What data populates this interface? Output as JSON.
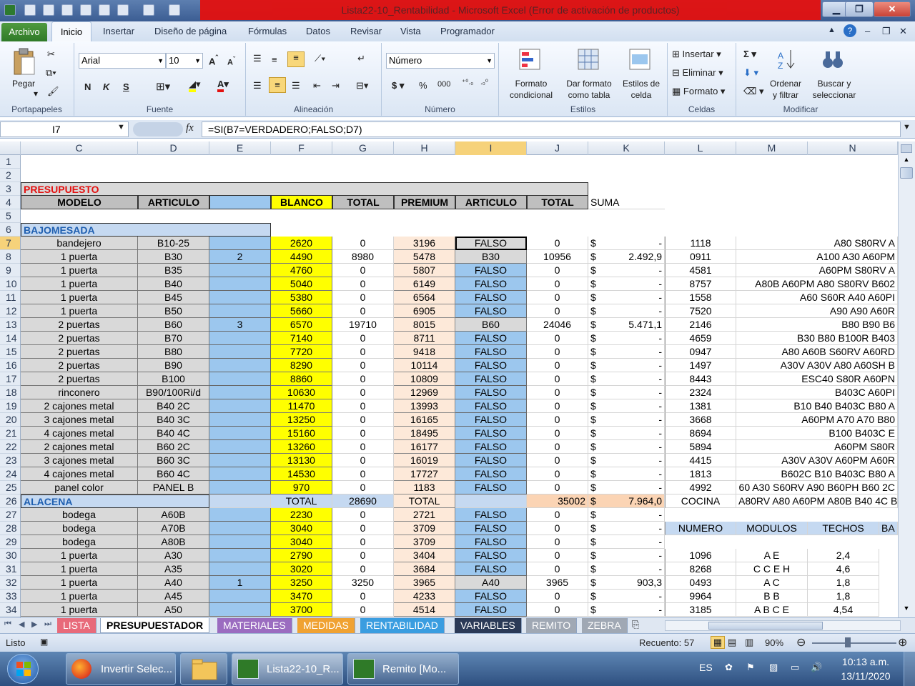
{
  "window": {
    "title": "Lista22-10_Rentabilidad  -  Microsoft Excel (Error de activación de productos)"
  },
  "ribbon_tabs": [
    "Archivo",
    "Inicio",
    "Insertar",
    "Diseño de página",
    "Fórmulas",
    "Datos",
    "Revisar",
    "Vista",
    "Programador"
  ],
  "ribbon": {
    "paste": "Pegar",
    "clipboard_group": "Portapapeles",
    "font_name": "Arial",
    "font_size": "10",
    "font_group": "Fuente",
    "bold": "N",
    "italic": "K",
    "underline": "S",
    "align_group": "Alineación",
    "number_format": "Número",
    "number_group": "Número",
    "percent": "%",
    "thousands": "000",
    "currency": "$",
    "cond_format_1": "Formato",
    "cond_format_2": "condicional",
    "table_format_1": "Dar formato",
    "table_format_2": "como tabla",
    "cell_styles_1": "Estilos de",
    "cell_styles_2": "celda",
    "styles_group": "Estilos",
    "insert": "Insertar",
    "delete": "Eliminar",
    "format": "Formato",
    "cells_group": "Celdas",
    "sort_1": "Ordenar",
    "sort_2": "y filtrar",
    "find_1": "Buscar y",
    "find_2": "seleccionar",
    "modify_group": "Modificar"
  },
  "formula_bar": {
    "name_box": "I7",
    "fx": "fx",
    "formula": "=SI(B7=VERDADERO;FALSO;D7)"
  },
  "columns": [
    "C",
    "D",
    "E",
    "F",
    "G",
    "H",
    "I",
    "J",
    "K",
    "L",
    "M",
    "N"
  ],
  "rows": [
    "1",
    "2",
    "3",
    "4",
    "5",
    "6",
    "7",
    "8",
    "9",
    "10",
    "11",
    "12",
    "13",
    "14",
    "15",
    "16",
    "17",
    "18",
    "19",
    "20",
    "21",
    "22",
    "23",
    "24",
    "25",
    "26",
    "27",
    "28",
    "29",
    "30",
    "31",
    "32",
    "33",
    "34"
  ],
  "sheet": {
    "presupuesto": "PRESUPUESTO",
    "headers": [
      "MODELO",
      "ARTICULO",
      "",
      "BLANCO",
      "TOTAL",
      "PREMIUM",
      "ARTICULO",
      "TOTAL"
    ],
    "suma": "SUMA",
    "bajomesada": "BAJOMESADA",
    "alacena": "ALACENA",
    "total_label": "TOTAL",
    "total_g": "28690",
    "total_label2": "TOTAL",
    "total_j": "35002",
    "total_k": "7.964,0",
    "cocina": "COCINA",
    "cocina_m": "A80RV A80 A60PM A80B B40 4C B",
    "lower_headers": [
      "NUMERO",
      "MODULOS",
      "TECHOS",
      "BA"
    ],
    "rows_bm": [
      [
        "bandejero",
        "B10-25",
        "",
        "2620",
        "0",
        "3196",
        "FALSO",
        "0",
        "$",
        "-",
        "1118",
        "A80 S80RV A"
      ],
      [
        "1 puerta",
        "B30",
        "2",
        "4490",
        "8980",
        "5478",
        "B30",
        "10956",
        "$",
        "2.492,9",
        "0911",
        "A100 A30 A60PM"
      ],
      [
        "1 puerta",
        "B35",
        "",
        "4760",
        "0",
        "5807",
        "FALSO",
        "0",
        "$",
        "-",
        "4581",
        "A60PM S80RV A"
      ],
      [
        "1 puerta",
        "B40",
        "",
        "5040",
        "0",
        "6149",
        "FALSO",
        "0",
        "$",
        "-",
        "8757",
        "A80B A60PM A80 S80RV B602"
      ],
      [
        "1 puerta",
        "B45",
        "",
        "5380",
        "0",
        "6564",
        "FALSO",
        "0",
        "$",
        "-",
        "1558",
        "A60 S60R A40 A60PI"
      ],
      [
        "1 puerta",
        "B50",
        "",
        "5660",
        "0",
        "6905",
        "FALSO",
        "0",
        "$",
        "-",
        "7520",
        "A90 A90 A60R"
      ],
      [
        "2 puertas",
        "B60",
        "3",
        "6570",
        "19710",
        "8015",
        "B60",
        "24046",
        "$",
        "5.471,1",
        "2146",
        "B80 B90 B6"
      ],
      [
        "2 puertas",
        "B70",
        "",
        "7140",
        "0",
        "8711",
        "FALSO",
        "0",
        "$",
        "-",
        "4659",
        "B30 B80 B100R B403"
      ],
      [
        "2 puertas",
        "B80",
        "",
        "7720",
        "0",
        "9418",
        "FALSO",
        "0",
        "$",
        "-",
        "0947",
        "A80 A60B S60RV A60RD"
      ],
      [
        "2 puertas",
        "B90",
        "",
        "8290",
        "0",
        "10114",
        "FALSO",
        "0",
        "$",
        "-",
        "1497",
        "A30V A30V A80 A60SH B"
      ],
      [
        "2 puertas",
        "B100",
        "",
        "8860",
        "0",
        "10809",
        "FALSO",
        "0",
        "$",
        "-",
        "8443",
        "ESC40 S80R A60PN"
      ],
      [
        "rinconero",
        "B90/100Ri/d",
        "",
        "10630",
        "0",
        "12969",
        "FALSO",
        "0",
        "$",
        "-",
        "2324",
        "B403C A60PI"
      ],
      [
        "2 cajones metal",
        "B40 2C",
        "",
        "11470",
        "0",
        "13993",
        "FALSO",
        "0",
        "$",
        "-",
        "1381",
        "B10 B40 B403C B80 A"
      ],
      [
        "3 cajones metal",
        "B40 3C",
        "",
        "13250",
        "0",
        "16165",
        "FALSO",
        "0",
        "$",
        "-",
        "3668",
        "A60PM A70 A70 B80"
      ],
      [
        "4 cajones metal",
        "B40 4C",
        "",
        "15160",
        "0",
        "18495",
        "FALSO",
        "0",
        "$",
        "-",
        "8694",
        "B100 B403C E"
      ],
      [
        "2 cajones metal",
        "B60 2C",
        "",
        "13260",
        "0",
        "16177",
        "FALSO",
        "0",
        "$",
        "-",
        "5894",
        "A60PM S80R"
      ],
      [
        "3 cajones metal",
        "B60 3C",
        "",
        "13130",
        "0",
        "16019",
        "FALSO",
        "0",
        "$",
        "-",
        "4415",
        "A30V A30V A60PM A60R"
      ],
      [
        "4 cajones metal",
        "B60 4C",
        "",
        "14530",
        "0",
        "17727",
        "FALSO",
        "0",
        "$",
        "-",
        "1813",
        "B602C B10 B403C B80 A"
      ],
      [
        "panel color",
        "PANEL B",
        "",
        "970",
        "0",
        "1183",
        "FALSO",
        "0",
        "$",
        "-",
        "4992",
        "60 A30 S60RV A90 B60PH B60 2C"
      ]
    ],
    "rows_al": [
      [
        "bodega",
        "A60B",
        "",
        "2230",
        "0",
        "2721",
        "FALSO",
        "0",
        "$",
        "-",
        "",
        "",
        ""
      ],
      [
        "bodega",
        "A70B",
        "",
        "3040",
        "0",
        "3709",
        "FALSO",
        "0",
        "$",
        "-",
        "",
        "",
        ""
      ],
      [
        "bodega",
        "A80B",
        "",
        "3040",
        "0",
        "3709",
        "FALSO",
        "0",
        "$",
        "-",
        "",
        "",
        ""
      ],
      [
        "1 puerta",
        "A30",
        "",
        "2790",
        "0",
        "3404",
        "FALSO",
        "0",
        "$",
        "-",
        "1096",
        "A E",
        "2,4"
      ],
      [
        "1 puerta",
        "A35",
        "",
        "3020",
        "0",
        "3684",
        "FALSO",
        "0",
        "$",
        "-",
        "8268",
        "C C E H",
        "4,6"
      ],
      [
        "1 puerta",
        "A40",
        "1",
        "3250",
        "3250",
        "3965",
        "A40",
        "3965",
        "$",
        "903,3",
        "0493",
        "A C",
        "1,8"
      ],
      [
        "1 puerta",
        "A45",
        "",
        "3470",
        "0",
        "4233",
        "FALSO",
        "0",
        "$",
        "-",
        "9964",
        "B B",
        "1,8"
      ],
      [
        "1 puerta",
        "A50",
        "",
        "3700",
        "0",
        "4514",
        "FALSO",
        "0",
        "$",
        "-",
        "3185",
        "A B C E",
        "4,54"
      ]
    ]
  },
  "sheet_tabs": [
    "LISTA",
    "PRESUPUESTADOR",
    "MATERIALES",
    "MEDIDAS",
    "RENTABILIDAD",
    "VARIABLES",
    "REMITO",
    "ZEBRA"
  ],
  "status": {
    "ready": "Listo",
    "count": "Recuento: 57",
    "zoom": "90%"
  },
  "taskbar": {
    "apps": [
      "Invertir Selec...",
      "",
      "Lista22-10_R...",
      "Remito  [Mo..."
    ],
    "lang": "ES",
    "time": "10:13 a.m.",
    "date": "13/11/2020"
  },
  "colors": {
    "yellow": "#ffff00",
    "lightblue": "#9cc7ee",
    "pink": "#fde9d9",
    "gray": "#d9d9d9",
    "red": "#e3100f",
    "green": "#2f7a28"
  }
}
